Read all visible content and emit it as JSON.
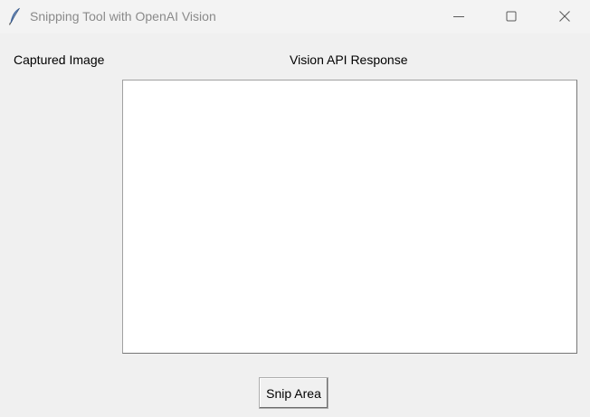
{
  "window": {
    "title": "Snipping Tool with OpenAI Vision",
    "app_icon": "feather-icon",
    "controls": {
      "minimize_icon": "minimize-icon",
      "maximize_icon": "maximize-icon",
      "close_icon": "close-icon"
    }
  },
  "main": {
    "captured_image_label": "Captured Image",
    "response_label": "Vision API Response",
    "response_text": ""
  },
  "actions": {
    "snip_label": "Snip Area"
  },
  "colors": {
    "window_bg": "#f0f0f0",
    "titlebar_bg": "#f3f3f3",
    "title_text": "#8a8a8a",
    "textbox_bg": "#ffffff",
    "textbox_border": "#a0a0a0"
  }
}
